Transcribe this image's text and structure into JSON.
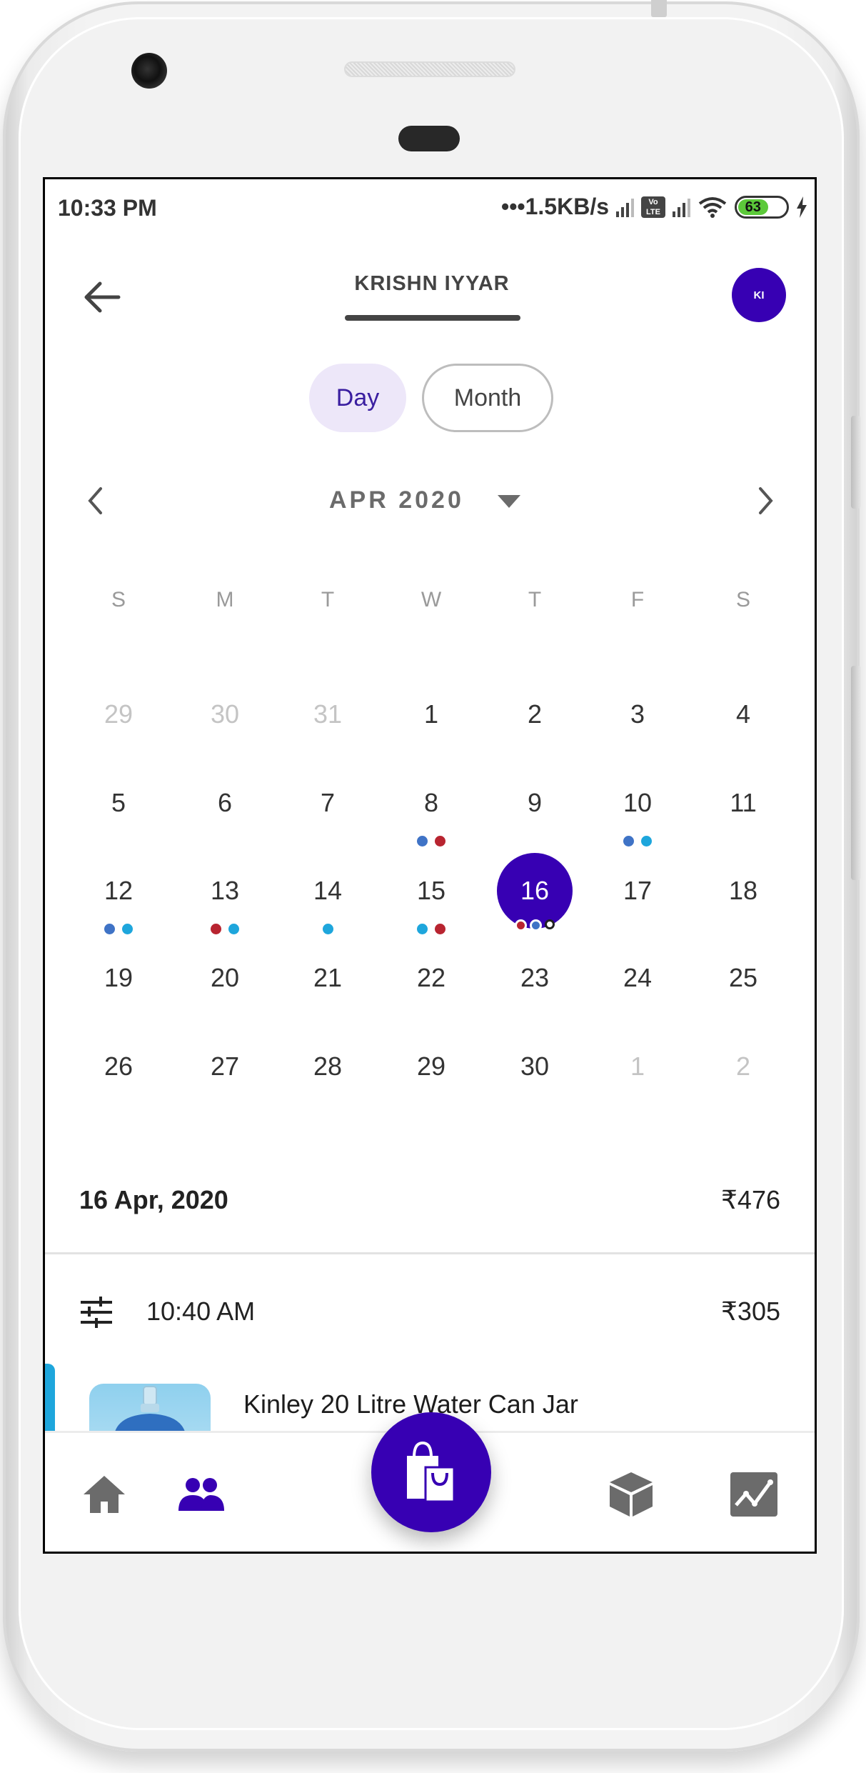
{
  "status_bar": {
    "time": "10:33 PM",
    "network_speed": "1.5KB/s",
    "volte_label": "Vo LTE",
    "battery_level": "63"
  },
  "header": {
    "title": "KRISHN IYYAR",
    "avatar_initials": "KI",
    "back_icon": "arrow-left-icon"
  },
  "view_toggle": {
    "options": [
      "Day",
      "Month"
    ],
    "selected": "Day"
  },
  "calendar": {
    "month_label": "APR 2020",
    "weekdays": [
      "S",
      "M",
      "T",
      "W",
      "T",
      "F",
      "S"
    ],
    "selected_day": "16",
    "dot_colors": {
      "blue": "#3f73c6",
      "red": "#b82430",
      "cyan": "#1ea6dc",
      "hollow": "#ffffff"
    },
    "weeks": [
      [
        {
          "d": "29",
          "muted": true
        },
        {
          "d": "30",
          "muted": true
        },
        {
          "d": "31",
          "muted": true
        },
        {
          "d": "1"
        },
        {
          "d": "2"
        },
        {
          "d": "3"
        },
        {
          "d": "4"
        }
      ],
      [
        {
          "d": "5"
        },
        {
          "d": "6"
        },
        {
          "d": "7"
        },
        {
          "d": "8",
          "dots": [
            "blue",
            "red"
          ]
        },
        {
          "d": "9"
        },
        {
          "d": "10",
          "dots": [
            "blue",
            "cyan"
          ]
        },
        {
          "d": "11"
        }
      ],
      [
        {
          "d": "12",
          "dots": [
            "blue",
            "cyan"
          ]
        },
        {
          "d": "13",
          "dots": [
            "red",
            "cyan"
          ]
        },
        {
          "d": "14",
          "dots": [
            "cyan"
          ]
        },
        {
          "d": "15",
          "dots": [
            "cyan",
            "red"
          ]
        },
        {
          "d": "16",
          "dots": [
            "red",
            "blue",
            "hollow"
          ],
          "selected": true
        },
        {
          "d": "17"
        },
        {
          "d": "18"
        }
      ],
      [
        {
          "d": "19"
        },
        {
          "d": "20"
        },
        {
          "d": "21"
        },
        {
          "d": "22"
        },
        {
          "d": "23"
        },
        {
          "d": "24"
        },
        {
          "d": "25"
        }
      ],
      [
        {
          "d": "26"
        },
        {
          "d": "27"
        },
        {
          "d": "28"
        },
        {
          "d": "29"
        },
        {
          "d": "30"
        },
        {
          "d": "1",
          "muted": true
        },
        {
          "d": "2",
          "muted": true
        }
      ]
    ]
  },
  "summary": {
    "date": "16 Apr, 2020",
    "total": "₹476"
  },
  "orders": [
    {
      "time": "10:40 AM",
      "amount": "₹305",
      "items": [
        {
          "name": "Kinley 20 Litre Water Can Jar",
          "accent_color": "#1ea6dc"
        }
      ]
    }
  ],
  "bottom_nav": {
    "items": [
      {
        "icon": "home-icon",
        "active": false
      },
      {
        "icon": "customers-icon",
        "active": true
      },
      {
        "icon": "shopping-bags-icon",
        "fab": true
      },
      {
        "icon": "box-icon",
        "active": false
      },
      {
        "icon": "analytics-icon",
        "active": false
      }
    ]
  },
  "colors": {
    "primary": "#3700b3",
    "toggle_bg": "#ede7f9",
    "text_dark": "#333333",
    "text_muted": "#c4c4c4",
    "icon_gray": "#6b6b6b"
  }
}
